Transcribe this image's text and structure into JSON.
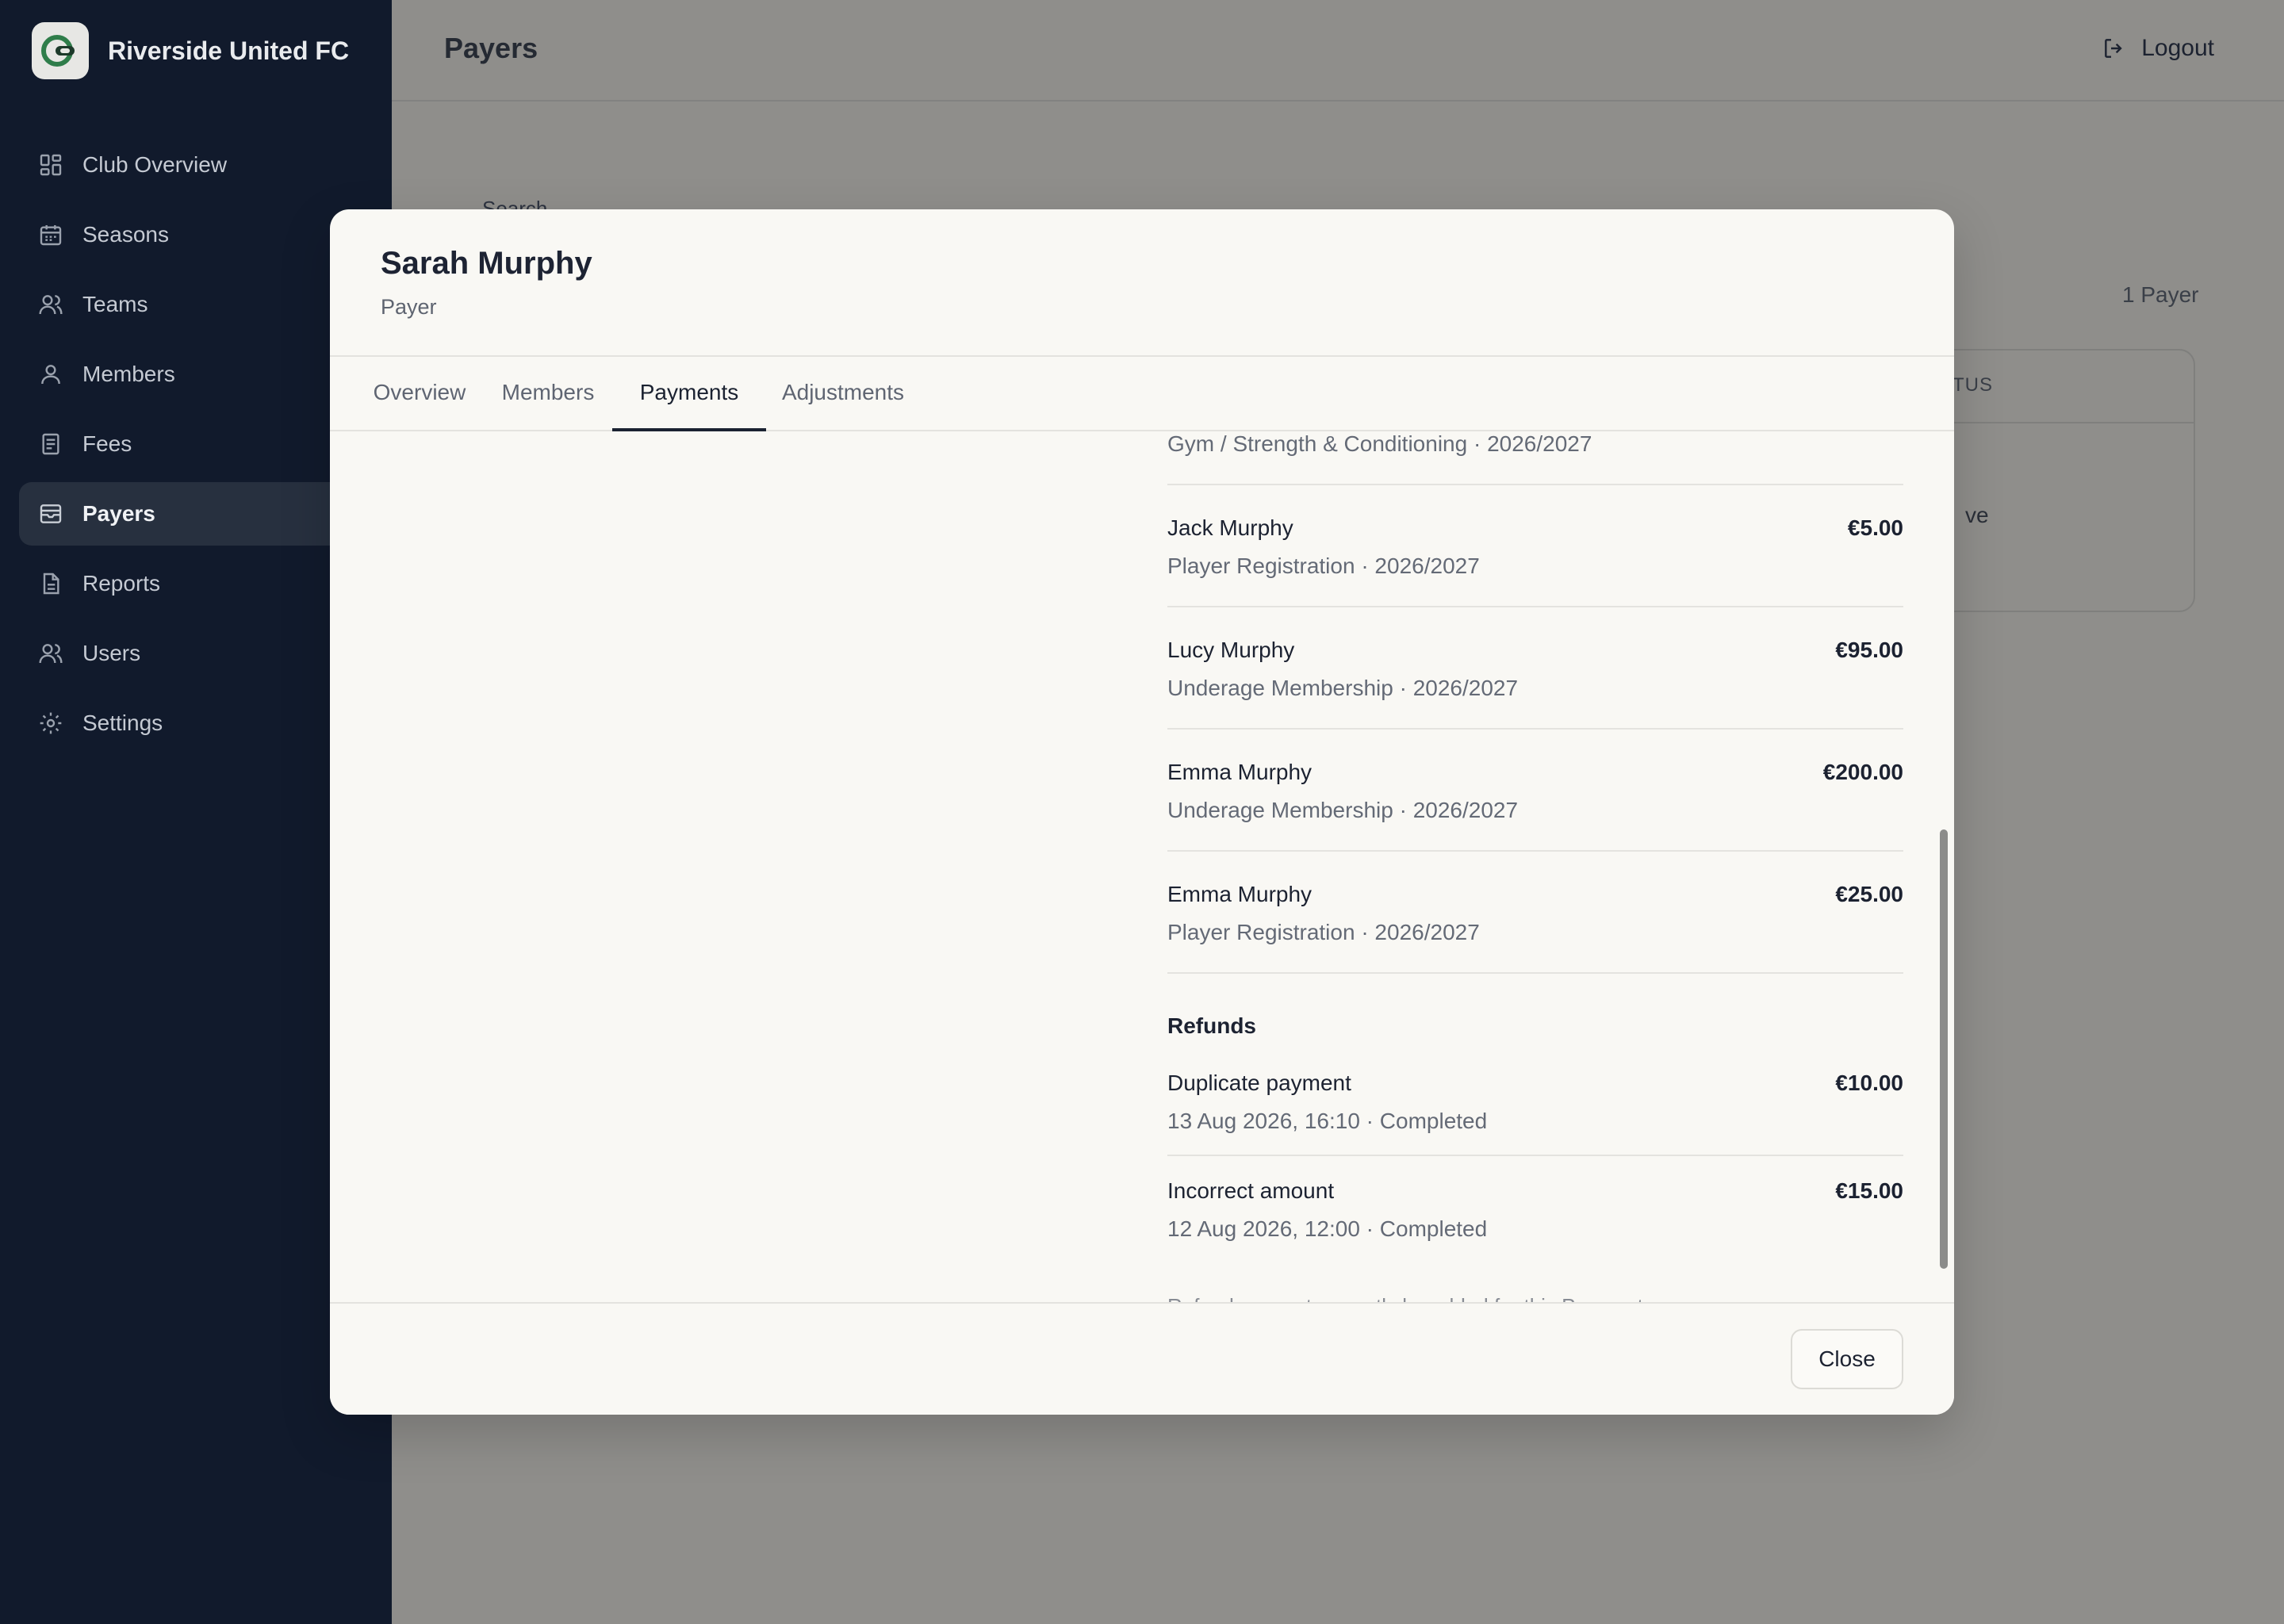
{
  "app": {
    "name": "Riverside United FC",
    "logo_icon": "club-logo-icon"
  },
  "sidebar": {
    "items": [
      {
        "label": "Club Overview",
        "icon": "grid-icon"
      },
      {
        "label": "Seasons",
        "icon": "calendar-icon"
      },
      {
        "label": "Teams",
        "icon": "users-icon"
      },
      {
        "label": "Members",
        "icon": "user-icon"
      },
      {
        "label": "Fees",
        "icon": "receipt-icon"
      },
      {
        "label": "Payers",
        "icon": "wallet-icon",
        "active": true
      },
      {
        "label": "Reports",
        "icon": "document-icon"
      },
      {
        "label": "Users",
        "icon": "users-icon"
      },
      {
        "label": "Settings",
        "icon": "gear-icon"
      }
    ]
  },
  "header": {
    "title": "Payers",
    "logout_label": "Logout"
  },
  "background": {
    "search_label": "Search",
    "count_label": "1 Payer",
    "status_header": "TUS",
    "status_cell": "ve"
  },
  "modal": {
    "title": "Sarah Murphy",
    "subtitle": "Payer",
    "tabs": [
      {
        "label": "Overview"
      },
      {
        "label": "Members"
      },
      {
        "label": "Payments",
        "active": true
      },
      {
        "label": "Adjustments"
      }
    ],
    "payments": {
      "partial_first_subtitle": "Gym / Strength & Conditioning · 2026/2027",
      "items": [
        {
          "name": "Jack Murphy",
          "detail": "Player Registration · 2026/2027",
          "amount": "€5.00"
        },
        {
          "name": "Lucy Murphy",
          "detail": "Underage Membership · 2026/2027",
          "amount": "€95.00"
        },
        {
          "name": "Emma Murphy",
          "detail": "Underage Membership · 2026/2027",
          "amount": "€200.00"
        },
        {
          "name": "Emma Murphy",
          "detail": "Player Registration · 2026/2027",
          "amount": "€25.00"
        }
      ]
    },
    "refunds": {
      "title": "Refunds",
      "items": [
        {
          "reason": "Duplicate payment",
          "detail": "13 Aug 2026, 16:10 · Completed",
          "amount": "€10.00"
        },
        {
          "reason": "Incorrect amount",
          "detail": "12 Aug 2026, 12:00 · Completed",
          "amount": "€15.00"
        }
      ],
      "footnote": "Refunds cannot currently be added for this Payment"
    },
    "close_label": "Close"
  },
  "colors": {
    "sidebar_bg": "#111a2c",
    "overlay_bg": "#8f8e8b",
    "modal_bg": "#f9f8f4",
    "text_primary": "#1c2231",
    "text_muted": "#646a76",
    "logo_green": "#2f7d4a"
  }
}
